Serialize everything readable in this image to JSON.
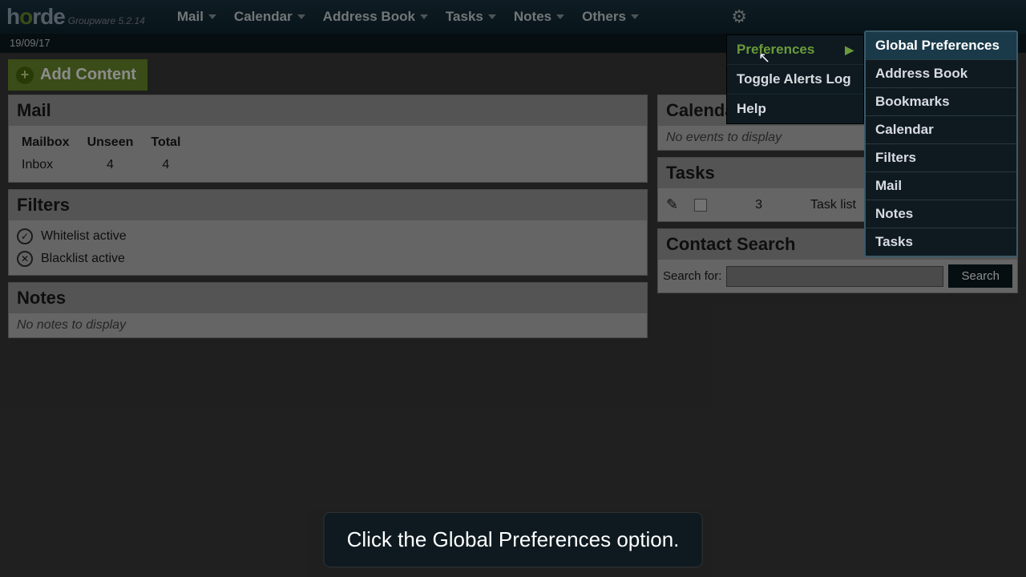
{
  "brand": {
    "name": "horde",
    "version": "Groupware 5.2.14"
  },
  "nav": {
    "mail": "Mail",
    "calendar": "Calendar",
    "addressbook": "Address Book",
    "tasks": "Tasks",
    "notes": "Notes",
    "others": "Others"
  },
  "date": "19/09/17",
  "add_content": "Add Content",
  "panels": {
    "mail": {
      "title": "Mail",
      "cols": {
        "mailbox": "Mailbox",
        "unseen": "Unseen",
        "total": "Total"
      },
      "row": {
        "name": "Inbox",
        "unseen": "4",
        "total": "4"
      }
    },
    "filters": {
      "title": "Filters",
      "whitelist": "Whitelist active",
      "blacklist": "Blacklist active"
    },
    "notes": {
      "title": "Notes",
      "empty": "No notes to display"
    },
    "calendar": {
      "title": "Calendar",
      "empty": "No events to display"
    },
    "tasks": {
      "title": "Tasks",
      "count": "3",
      "listlabel": "Task list"
    },
    "contact": {
      "title": "Contact Search",
      "label": "Search for:",
      "button": "Search"
    }
  },
  "gear_menu": {
    "preferences": "Preferences",
    "toggle": "Toggle Alerts Log",
    "help": "Help"
  },
  "prefs_submenu": {
    "global": "Global Preferences",
    "addressbook": "Address Book",
    "bookmarks": "Bookmarks",
    "calendar": "Calendar",
    "filters": "Filters",
    "mail": "Mail",
    "notes": "Notes",
    "tasks": "Tasks"
  },
  "tooltip": "Click the Global Preferences option."
}
